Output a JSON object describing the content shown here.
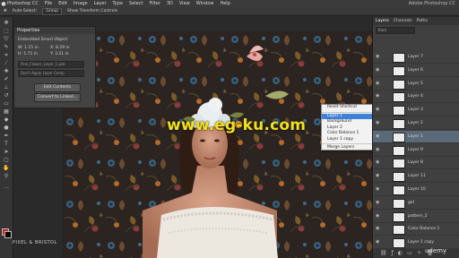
{
  "app": {
    "name": "Photoshop CC",
    "menus": [
      "File",
      "Edit",
      "Image",
      "Layer",
      "Type",
      "Select",
      "Filter",
      "3D",
      "View",
      "Window",
      "Help"
    ],
    "window_title": "Adobe Photoshop CC"
  },
  "options_bar": {
    "auto_select": "Auto-Select:",
    "auto_select_value": "Group",
    "show_transform": "Show Transform Controls"
  },
  "properties": {
    "title": "Properties",
    "subtitle": "Embedded Smart Object",
    "w_label": "W:",
    "w_value": "1.15 in",
    "h_label": "H:",
    "h_value": "1.71 in",
    "x_label": "X:",
    "x_value": "8.29 in",
    "y_label": "Y:",
    "y_value": "3.21 in",
    "file_field": "Pink_Flower_Layer_1.psb",
    "layer_comp": "Don't Apply Layer Comp",
    "edit_contents": "Edit Contents",
    "convert_linked": "Convert to Linked..."
  },
  "context_menu": {
    "items": [
      "Reset Shortcut",
      "Layer 1",
      "Background",
      "Layer 2",
      "Color Balance 1",
      "Layer 1 copy",
      "Merge Layers"
    ],
    "highlighted_index": 1
  },
  "layers": {
    "tabs": [
      "Layers",
      "Channels",
      "Paths"
    ],
    "kind_label": "Kind",
    "rows": [
      {
        "name": "Layer 7"
      },
      {
        "name": "Layer 6"
      },
      {
        "name": "Layer 5"
      },
      {
        "name": "Layer 4"
      },
      {
        "name": "Layer 3"
      },
      {
        "name": "Layer 2"
      },
      {
        "name": "Layer 1"
      },
      {
        "name": "Layer 9"
      },
      {
        "name": "Layer 8"
      },
      {
        "name": "Layer 11"
      },
      {
        "name": "Layer 10"
      },
      {
        "name": "girl"
      },
      {
        "name": "pattern_2"
      },
      {
        "name": "Color Balance 1"
      },
      {
        "name": "Layer 1 copy"
      }
    ],
    "selected_index": 6
  },
  "watermark": "www.eg-ku.com",
  "brand": "PIXEL & BRISTOL",
  "udemy": "udemy",
  "colors": {
    "highlight": "#3d82d6",
    "watermark": "#f2e11b",
    "selected_layer": "#5b6a78"
  }
}
